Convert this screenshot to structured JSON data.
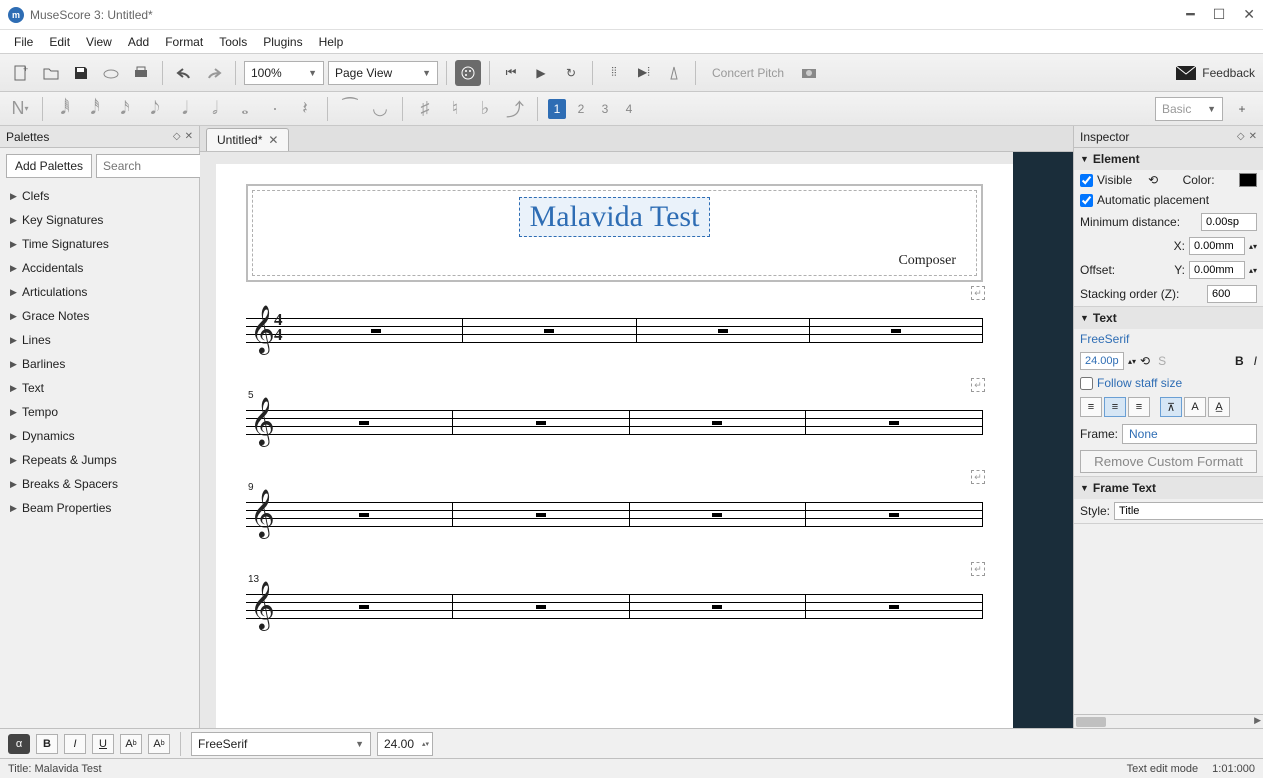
{
  "window": {
    "title": "MuseScore 3: Untitled*"
  },
  "menu": [
    "File",
    "Edit",
    "View",
    "Add",
    "Format",
    "Tools",
    "Plugins",
    "Help"
  ],
  "toolbar": {
    "zoom": "100%",
    "view_mode": "Page View",
    "concert_pitch": "Concert Pitch",
    "feedback": "Feedback"
  },
  "notebar": {
    "voices": [
      "1",
      "2",
      "3",
      "4"
    ],
    "workspace": "Basic"
  },
  "palettes": {
    "title": "Palettes",
    "add_btn": "Add Palettes",
    "search_ph": "Search",
    "items": [
      "Clefs",
      "Key Signatures",
      "Time Signatures",
      "Accidentals",
      "Articulations",
      "Grace Notes",
      "Lines",
      "Barlines",
      "Text",
      "Tempo",
      "Dynamics",
      "Repeats & Jumps",
      "Breaks & Spacers",
      "Beam Properties"
    ]
  },
  "tabs": [
    {
      "label": "Untitled*"
    }
  ],
  "score": {
    "title": "Malavida Test",
    "composer": "Composer",
    "timesig_top": "4",
    "timesig_bot": "4",
    "systems": [
      {
        "num": ""
      },
      {
        "num": "5"
      },
      {
        "num": "9"
      },
      {
        "num": "13"
      }
    ]
  },
  "inspector": {
    "title": "Inspector",
    "element": {
      "header": "Element",
      "visible": "Visible",
      "color": "Color:",
      "autoplace": "Automatic placement",
      "mindist_lbl": "Minimum distance:",
      "mindist": "0.00sp",
      "offset_lbl": "Offset:",
      "x_lbl": "X:",
      "x": "0.00mm",
      "y_lbl": "Y:",
      "y": "0.00mm",
      "stack_lbl": "Stacking order (Z):",
      "stack": "600"
    },
    "text": {
      "header": "Text",
      "font": "FreeSerif",
      "size": "24.00p",
      "follow": "Follow staff size",
      "frame_lbl": "Frame:",
      "frame": "None",
      "remove": "Remove Custom Formatt"
    },
    "frametext": {
      "header": "Frame Text",
      "style_lbl": "Style:",
      "style": "Title"
    }
  },
  "fmtbar": {
    "font": "FreeSerif",
    "size": "24.00"
  },
  "status": {
    "left": "Title: Malavida Test",
    "mode": "Text edit mode",
    "pos": "1:01:000"
  }
}
